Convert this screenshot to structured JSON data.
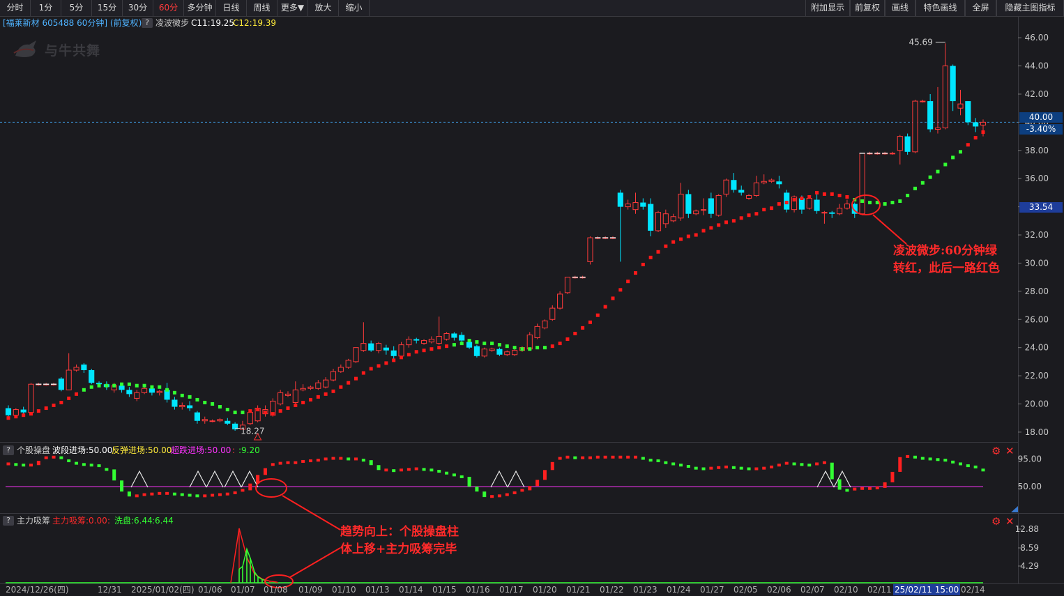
{
  "toolbar": {
    "left": [
      "分时",
      "1分",
      "5分",
      "15分",
      "30分",
      "60分",
      "多分钟",
      "日线",
      "周线",
      "更多▼",
      "放大",
      "缩小"
    ],
    "right": [
      "附加显示",
      "前复权",
      "画线",
      "特色画线",
      "全屏",
      "隐藏主图指标"
    ]
  },
  "main_header": {
    "stock": "[福莱新材 605488 60分钟] (前复权)",
    "q": "?",
    "indicator": "凌波微步",
    "c1": "C11:19.25",
    "c2": "C12:19.39"
  },
  "logo_text": "与牛共舞",
  "price_axis": [
    "46.00",
    "44.00",
    "42.00",
    "40.00",
    "38.00",
    "36.00",
    "34.00",
    "32.00",
    "30.00",
    "28.00",
    "26.00",
    "24.00",
    "22.00",
    "20.00",
    "18.00"
  ],
  "current_price": "40.00",
  "current_change": "-3.40%",
  "crosshair_price": "33.54",
  "high_label": "45.69",
  "low_label": "18.27",
  "sub1": {
    "q": "?",
    "name": "个股操盘",
    "v1": "波段进场:50.00",
    "v2": "反弹进场:50.00",
    "v3": "超跌进场:50.00",
    "v4": ":",
    "v5": ":9.20",
    "axis": [
      "95.00",
      "50.00"
    ]
  },
  "sub2": {
    "q": "?",
    "name": "主力吸筹",
    "v1": "主力吸筹:0.00",
    "v2": ":",
    "v3": "洗盘:6.44",
    "v4": ":6.44",
    "axis": [
      "12.88",
      "8.59",
      "4.29"
    ]
  },
  "annotations": {
    "a1_line1": "凌波微步:60分钟绿",
    "a1_line2": "转红，此后一路红色",
    "a2_line1": "趋势向上：个股操盘柱",
    "a2_line2": "体上移+主力吸筹完毕"
  },
  "time_axis": [
    "2024/12/26(四)",
    "12/31",
    "2025/01/02(四)",
    "01/06",
    "01/07",
    "01/08",
    "01/09",
    "01/10",
    "01/13",
    "01/14",
    "01/15",
    "01/16",
    "01/17",
    "01/20",
    "01/21",
    "01/22",
    "01/23",
    "01/24",
    "01/27",
    "02/05",
    "02/06",
    "02/07",
    "02/10",
    "02/11",
    "25/02/11 15:00",
    "02/14"
  ],
  "colors": {
    "up": "#ff3b3b",
    "down": "#00e5ff",
    "ma_up": "#ff1a1a",
    "ma_down": "#33ff33",
    "magenta": "#ff33ff",
    "accent_blue": "#1e3d9a"
  },
  "chart_data": {
    "type": "candlestick",
    "ylim": [
      17.5,
      46.8
    ],
    "candles": [
      [
        19.7,
        19.2,
        19.9,
        19.1
      ],
      [
        19.2,
        19.6,
        19.7,
        19.1
      ],
      [
        19.6,
        19.4,
        19.8,
        19.3
      ],
      [
        19.4,
        21.4,
        21.5,
        19.3
      ],
      [
        21.4,
        21.4,
        21.5,
        21.3
      ],
      [
        21.4,
        21.4,
        21.5,
        21.3
      ],
      [
        21.4,
        21.4,
        21.5,
        21.3
      ],
      [
        21.8,
        21.0,
        21.9,
        20.9
      ],
      [
        21.0,
        22.4,
        23.6,
        21.0
      ],
      [
        22.4,
        22.6,
        22.8,
        22.3
      ],
      [
        22.8,
        22.4,
        22.9,
        22.2
      ],
      [
        22.4,
        21.5,
        22.5,
        21.4
      ],
      [
        21.5,
        21.4,
        21.6,
        21.2
      ],
      [
        21.4,
        21.2,
        21.6,
        21.0
      ],
      [
        21.0,
        21.3,
        21.5,
        20.8
      ],
      [
        21.3,
        21.0,
        21.4,
        20.8
      ],
      [
        21.0,
        20.7,
        21.2,
        20.5
      ],
      [
        20.4,
        20.8,
        21.0,
        20.2
      ],
      [
        20.8,
        21.1,
        21.2,
        20.7
      ],
      [
        21.1,
        20.8,
        21.3,
        20.6
      ],
      [
        20.8,
        20.9,
        21.0,
        20.6
      ],
      [
        21.0,
        20.3,
        21.5,
        20.1
      ],
      [
        20.3,
        19.8,
        20.5,
        19.6
      ],
      [
        19.8,
        19.9,
        20.1,
        19.6
      ],
      [
        19.9,
        19.7,
        20.2,
        19.5
      ],
      [
        19.4,
        18.8,
        19.5,
        18.6
      ],
      [
        18.8,
        18.9,
        19.1,
        18.6
      ],
      [
        18.8,
        18.8,
        18.9,
        18.7
      ],
      [
        18.8,
        18.9,
        19.0,
        18.7
      ],
      [
        18.8,
        18.6,
        19.0,
        18.5
      ],
      [
        18.6,
        18.2,
        18.7,
        18.1
      ],
      [
        18.2,
        18.5,
        18.8,
        18.2
      ],
      [
        18.6,
        19.4,
        19.6,
        18.5
      ],
      [
        18.8,
        19.7,
        19.9,
        18.7
      ],
      [
        19.3,
        19.6,
        19.9,
        19.1
      ],
      [
        19.2,
        20.2,
        20.4,
        19.1
      ],
      [
        20.0,
        20.8,
        21.0,
        19.9
      ],
      [
        20.6,
        20.7,
        20.9,
        20.5
      ],
      [
        20.1,
        21.0,
        21.6,
        20.0
      ],
      [
        21.0,
        21.1,
        21.4,
        20.9
      ],
      [
        21.1,
        21.2,
        21.3,
        21.0
      ],
      [
        21.1,
        21.5,
        21.7,
        21.0
      ],
      [
        21.2,
        21.7,
        21.9,
        21.1
      ],
      [
        21.7,
        22.3,
        22.5,
        21.6
      ],
      [
        22.3,
        22.6,
        22.8,
        22.2
      ],
      [
        22.6,
        23.1,
        23.2,
        22.5
      ],
      [
        23.0,
        24.0,
        24.0,
        22.9
      ],
      [
        23.8,
        24.3,
        25.8,
        23.7
      ],
      [
        24.3,
        23.8,
        24.5,
        23.7
      ],
      [
        23.8,
        24.3,
        24.4,
        23.6
      ],
      [
        24.0,
        23.8,
        24.2,
        23.5
      ],
      [
        23.8,
        23.4,
        24.1,
        23.2
      ],
      [
        23.4,
        24.2,
        24.4,
        23.3
      ],
      [
        24.2,
        24.6,
        24.8,
        24.0
      ],
      [
        24.6,
        24.5,
        24.7,
        24.3
      ],
      [
        24.3,
        24.5,
        24.6,
        24.2
      ],
      [
        24.4,
        24.6,
        24.8,
        24.3
      ],
      [
        24.3,
        24.8,
        26.2,
        24.2
      ],
      [
        24.6,
        25.0,
        25.1,
        24.5
      ],
      [
        25.0,
        24.7,
        25.1,
        24.5
      ],
      [
        24.9,
        24.5,
        25.1,
        24.3
      ],
      [
        24.4,
        24.0,
        24.5,
        23.9
      ],
      [
        24.1,
        23.4,
        24.2,
        23.3
      ],
      [
        23.4,
        23.9,
        24.0,
        23.3
      ],
      [
        23.8,
        23.9,
        24.0,
        23.7
      ],
      [
        23.9,
        23.5,
        24.0,
        23.4
      ],
      [
        23.5,
        23.7,
        23.8,
        23.4
      ],
      [
        23.5,
        23.8,
        24.0,
        23.4
      ],
      [
        23.8,
        24.0,
        24.1,
        23.7
      ],
      [
        23.9,
        24.9,
        25.1,
        23.8
      ],
      [
        24.7,
        25.5,
        25.7,
        24.6
      ],
      [
        25.4,
        25.9,
        26.0,
        25.3
      ],
      [
        26.0,
        26.8,
        27.0,
        25.9
      ],
      [
        26.8,
        27.8,
        28.0,
        26.7
      ],
      [
        27.9,
        29.0,
        29.0,
        27.8
      ],
      [
        29.0,
        29.0,
        29.1,
        28.9
      ],
      [
        29.0,
        29.0,
        29.1,
        28.9
      ],
      [
        30.1,
        31.8,
        31.9,
        29.9
      ],
      [
        31.8,
        31.8,
        31.9,
        31.7
      ],
      [
        31.8,
        31.8,
        31.9,
        31.7
      ],
      [
        31.8,
        31.8,
        31.9,
        31.7
      ],
      [
        35.0,
        34.0,
        35.2,
        30.1
      ],
      [
        34.0,
        34.2,
        34.5,
        33.8
      ],
      [
        33.8,
        34.3,
        35.0,
        33.5
      ],
      [
        34.3,
        34.0,
        34.6,
        33.8
      ],
      [
        34.2,
        32.3,
        34.6,
        31.9
      ],
      [
        32.3,
        33.6,
        33.7,
        32.2
      ],
      [
        32.8,
        33.5,
        33.8,
        32.5
      ],
      [
        33.0,
        33.3,
        33.5,
        32.9
      ],
      [
        33.2,
        34.9,
        35.7,
        33.0
      ],
      [
        34.9,
        33.5,
        35.2,
        33.2
      ],
      [
        33.5,
        33.7,
        33.8,
        33.4
      ],
      [
        33.8,
        33.8,
        34.6,
        33.4
      ],
      [
        34.6,
        33.5,
        35.0,
        33.2
      ],
      [
        33.4,
        34.8,
        34.9,
        33.3
      ],
      [
        34.9,
        35.9,
        36.0,
        34.7
      ],
      [
        35.9,
        35.2,
        36.4,
        35.0
      ],
      [
        35.2,
        35.0,
        35.5,
        34.8
      ],
      [
        34.6,
        34.8,
        34.9,
        34.5
      ],
      [
        34.8,
        35.7,
        36.2,
        34.7
      ],
      [
        35.7,
        35.8,
        36.3,
        35.6
      ],
      [
        35.8,
        35.9,
        36.0,
        35.7
      ],
      [
        35.8,
        35.6,
        36.2,
        35.3
      ],
      [
        35.0,
        33.8,
        35.2,
        33.6
      ],
      [
        33.8,
        34.7,
        34.8,
        33.6
      ],
      [
        34.6,
        33.8,
        34.8,
        33.5
      ],
      [
        33.9,
        34.6,
        34.7,
        33.8
      ],
      [
        34.5,
        33.7,
        35.0,
        33.5
      ],
      [
        33.6,
        33.6,
        33.7,
        32.8
      ],
      [
        33.6,
        33.5,
        33.7,
        33.2
      ],
      [
        33.5,
        33.9,
        34.2,
        33.4
      ],
      [
        33.9,
        34.2,
        34.5,
        33.8
      ],
      [
        34.2,
        33.5,
        34.3,
        33.2
      ],
      [
        33.5,
        37.8,
        37.8,
        33.4
      ],
      [
        37.8,
        37.8,
        37.9,
        37.7
      ],
      [
        37.8,
        37.8,
        37.9,
        37.7
      ],
      [
        37.8,
        37.8,
        37.9,
        37.7
      ],
      [
        37.8,
        37.8,
        37.9,
        37.7
      ],
      [
        38.0,
        39.0,
        39.1,
        37.0
      ],
      [
        39.0,
        37.9,
        39.2,
        37.7
      ],
      [
        37.9,
        41.5,
        41.6,
        37.8
      ],
      [
        41.5,
        41.5,
        41.6,
        41.4
      ],
      [
        41.5,
        39.5,
        42.0,
        39.3
      ],
      [
        39.5,
        39.6,
        42.5,
        39.2
      ],
      [
        39.6,
        44.0,
        45.6,
        39.5
      ],
      [
        44.0,
        41.5,
        44.1,
        40.8
      ],
      [
        41.0,
        41.3,
        42.3,
        40.5
      ],
      [
        41.5,
        40.0,
        41.5,
        39.8
      ],
      [
        40.0,
        39.7,
        40.3,
        39.3
      ],
      [
        39.8,
        40.0,
        40.2,
        39.0
      ]
    ],
    "trail": [
      19.0,
      19.1,
      19.2,
      19.3,
      19.5,
      19.7,
      19.9,
      20.1,
      20.4,
      20.7,
      21.0,
      21.2,
      21.3,
      21.3,
      21.3,
      21.4,
      21.4,
      21.3,
      21.3,
      21.2,
      21.2,
      21.0,
      20.8,
      20.6,
      20.5,
      20.3,
      20.1,
      20.0,
      19.8,
      19.6,
      19.4,
      19.4,
      19.5,
      19.6,
      19.4,
      19.3,
      19.5,
      19.7,
      19.9,
      20.1,
      20.3,
      20.5,
      20.7,
      20.9,
      21.2,
      21.5,
      21.8,
      22.2,
      22.5,
      22.7,
      22.9,
      23.1,
      23.3,
      23.5,
      23.7,
      23.8,
      23.9,
      24.0,
      24.1,
      24.2,
      24.3,
      24.5,
      24.4,
      24.3,
      24.3,
      24.2,
      24.1,
      24.0,
      23.9,
      23.9,
      24.0,
      24.0,
      24.1,
      24.3,
      24.6,
      25.0,
      25.4,
      25.8,
      26.3,
      26.9,
      27.5,
      28.1,
      28.7,
      29.3,
      29.9,
      30.4,
      30.8,
      31.2,
      31.5,
      31.7,
      31.9,
      32.0,
      32.3,
      32.5,
      32.7,
      32.9,
      33.0,
      33.2,
      33.4,
      33.5,
      33.8,
      33.9,
      34.2,
      34.3,
      34.5,
      34.6,
      34.7,
      35.0,
      34.9,
      34.9,
      34.8,
      34.7,
      34.5,
      34.4,
      34.3,
      34.3,
      34.2,
      34.3,
      34.4,
      34.8,
      35.3,
      35.7,
      36.1,
      36.5,
      37.0,
      37.5,
      37.9,
      38.4,
      38.9,
      39.3,
      39.6,
      39.8,
      39.9,
      39.9
    ],
    "trail_colors": "RRRRRRRRRRGGGGGGGGGGGGGGGGGGGGGGRRRRRRRRRRRRRRRRRRRRRRRRRRRGGGGGGGGGGGGGRRRRRRRRRRRRRRRRRRRRRRRRRRRRRRRRRRRRRRRRGGGGGGGGGGGGGGGRRRRRRRRRRRRRRRRRR",
    "osc": [
      87,
      86,
      85,
      85,
      92,
      97,
      98,
      97,
      92,
      88,
      86,
      85,
      84,
      78,
      60,
      42,
      34,
      35,
      37,
      38,
      39,
      39,
      38,
      37,
      36,
      35,
      35,
      36,
      37,
      38,
      40,
      44,
      55,
      69,
      80,
      86,
      88,
      89,
      89,
      91,
      92,
      93,
      95,
      96,
      96,
      95,
      95,
      93,
      85,
      77,
      77,
      76,
      77,
      78,
      79,
      78,
      77,
      75,
      72,
      69,
      66,
      50,
      42,
      33,
      34,
      35,
      37,
      40,
      44,
      51,
      61,
      77,
      90,
      96,
      98,
      97,
      97,
      97,
      98,
      98,
      98,
      98,
      98,
      98,
      96,
      93,
      92,
      89,
      87,
      85,
      83,
      80,
      79,
      80,
      81,
      82,
      81,
      80,
      79,
      79,
      80,
      82,
      85,
      88,
      87,
      86,
      85,
      87,
      89,
      62,
      45,
      44,
      46,
      47,
      47,
      48,
      57,
      74,
      98,
      99,
      98,
      96,
      95,
      94,
      93,
      90,
      87,
      84,
      82,
      77,
      72,
      66,
      59
    ],
    "accum": [
      [
        331,
        0.0
      ],
      [
        343,
        1.0
      ],
      [
        354,
        0.47
      ],
      [
        365,
        0.16
      ],
      [
        376,
        0.07
      ],
      [
        387,
        0.03
      ],
      [
        398,
        0.01
      ]
    ],
    "wash": [
      [
        343,
        0.25
      ],
      [
        348,
        0.3
      ],
      [
        354,
        0.62
      ],
      [
        359,
        0.45
      ],
      [
        365,
        0.2
      ],
      [
        370,
        0.11
      ],
      [
        376,
        0.06
      ],
      [
        381,
        0.04
      ]
    ]
  }
}
